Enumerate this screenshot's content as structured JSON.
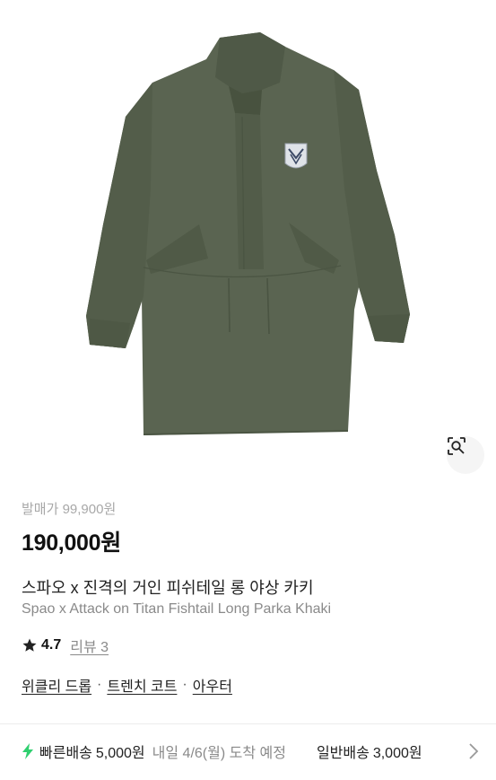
{
  "product": {
    "image_alt": "Khaki long fishtail parka",
    "release_price_label": "발매가 99,900원",
    "price": "190,000원",
    "title_kr": "스파오 x 진격의 거인 피쉬테일 롱 야상 카키",
    "title_en": "Spao x Attack on Titan Fishtail Long Parka Khaki"
  },
  "rating": {
    "icon": "star-icon",
    "value": "4.7",
    "reviews_label": "리뷰 3"
  },
  "categories": {
    "items": [
      "위클리 드롭",
      "트렌치 코트",
      "아우터"
    ],
    "separator": "·"
  },
  "shipping": {
    "fast_icon": "lightning-icon",
    "fast_label": "빠른배송",
    "fast_fee": "5,000원",
    "eta": "내일 4/6(월) 도착 예정",
    "standard_label": "일반배송",
    "standard_fee": "3,000원"
  },
  "colors": {
    "background": "#ffffff",
    "coat": "#596350",
    "fast_icon": "#2fcf6f",
    "muted_text": "#8a8a8a"
  }
}
